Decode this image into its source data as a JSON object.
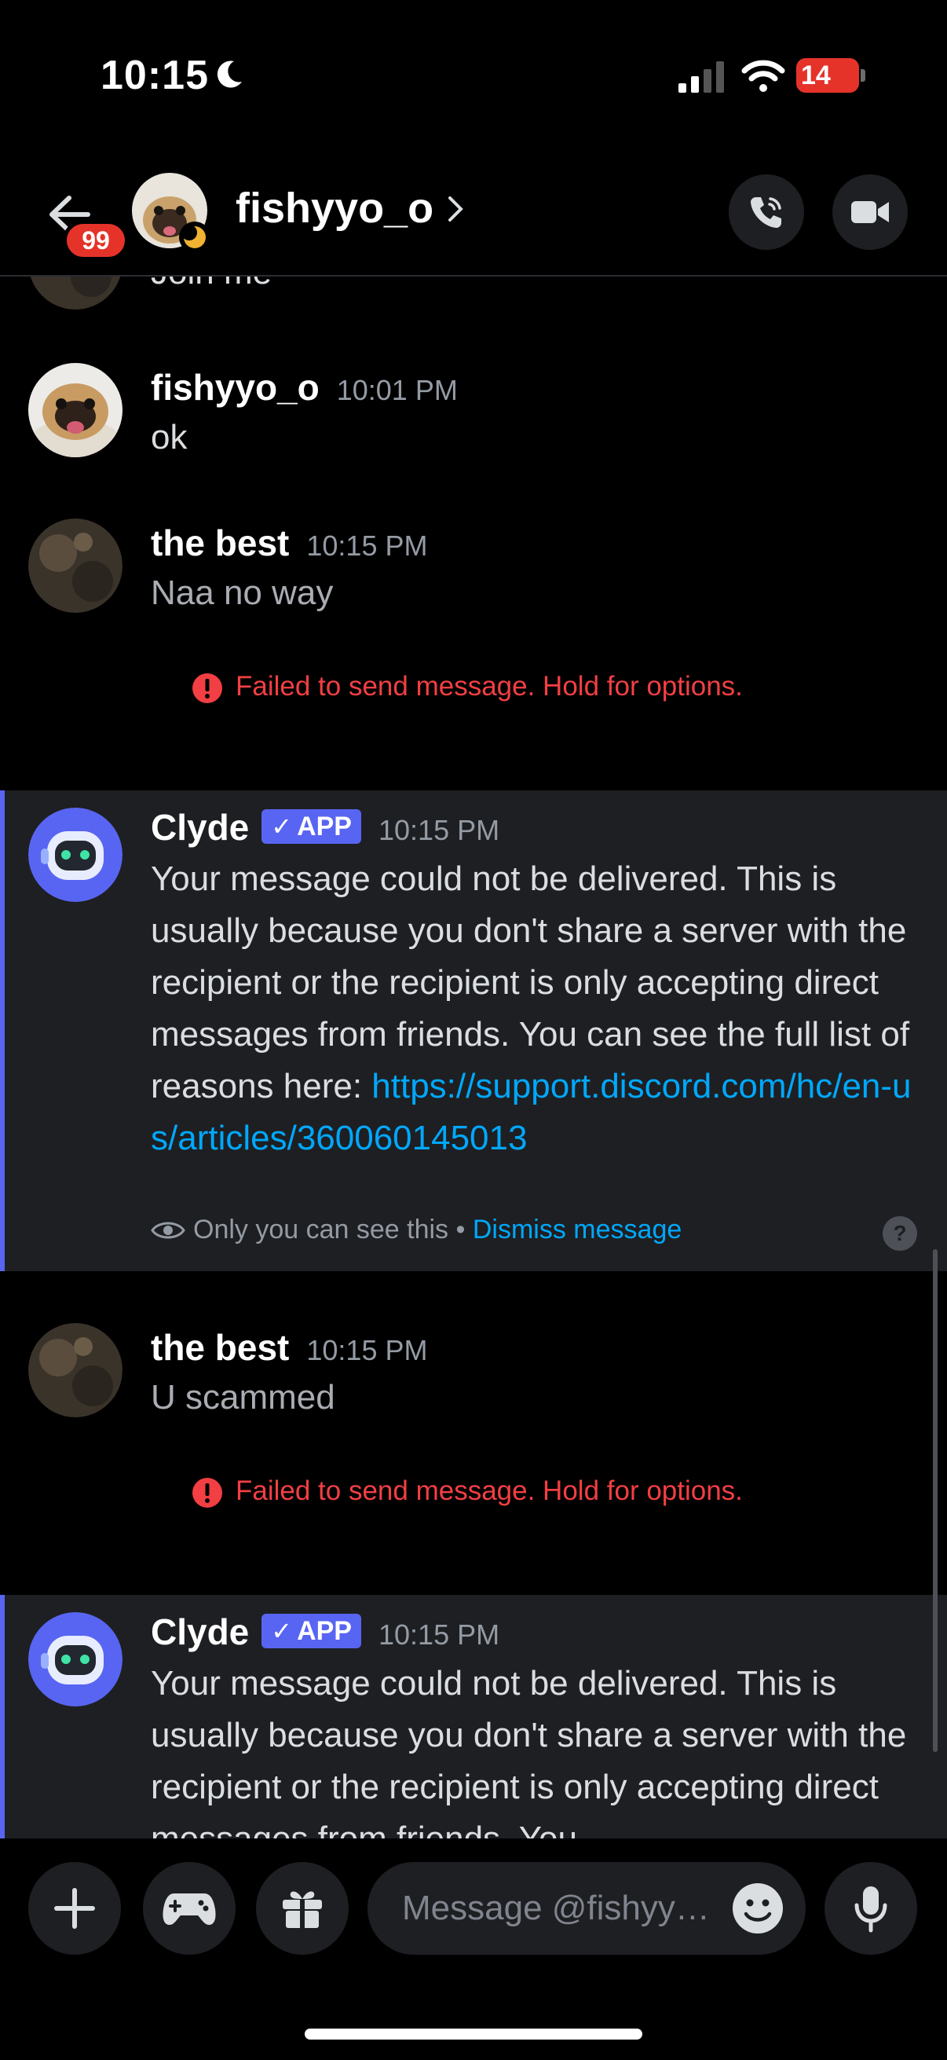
{
  "status_bar": {
    "time": "10:15",
    "battery": "14"
  },
  "header": {
    "unread_count": "99",
    "name": "fishyyo_o"
  },
  "messages": [
    {
      "author": "fishyyo_o",
      "time": "10:01 PM",
      "text": "ok"
    },
    {
      "author": "the best",
      "time": "10:15 PM",
      "text": "Naa no way",
      "error": "Failed to send message. Hold for options."
    },
    {
      "author": "Clyde",
      "badge": "APP",
      "time": "10:15 PM",
      "text": "Your message could not be delivered. This is usually because you don't share a server with the recipient or the recipient is only accepting direct messages from friends. You can see the full list of reasons here: ",
      "link": "https://support.discord.com/hc/en-us/articles/360060145013",
      "ephemeral": "Only you can see this",
      "separator": "•",
      "dismiss": "Dismiss message"
    },
    {
      "author": "the best",
      "time": "10:15 PM",
      "text": "U scammed",
      "error": "Failed to send message. Hold for options."
    },
    {
      "author": "Clyde",
      "badge": "APP",
      "time": "10:15 PM",
      "text": "Your message could not be delivered. This is usually because you don't share a server with the recipient or the recipient is only accepting direct messages from friends. You"
    }
  ],
  "partial_top_text": "Join me",
  "input": {
    "placeholder": "Message @fishyyo_o"
  },
  "colors": {
    "accent": "#5865f2",
    "error": "#f23f43",
    "link": "#00a8fc",
    "badge_red": "#e5332a"
  },
  "icons": [
    "moon-icon",
    "signal-icon",
    "wifi-icon",
    "back-arrow-icon",
    "phone-icon",
    "video-icon",
    "error-icon",
    "eye-icon",
    "help-icon",
    "plus-icon",
    "gamepad-icon",
    "gift-icon",
    "emoji-icon",
    "mic-icon"
  ]
}
